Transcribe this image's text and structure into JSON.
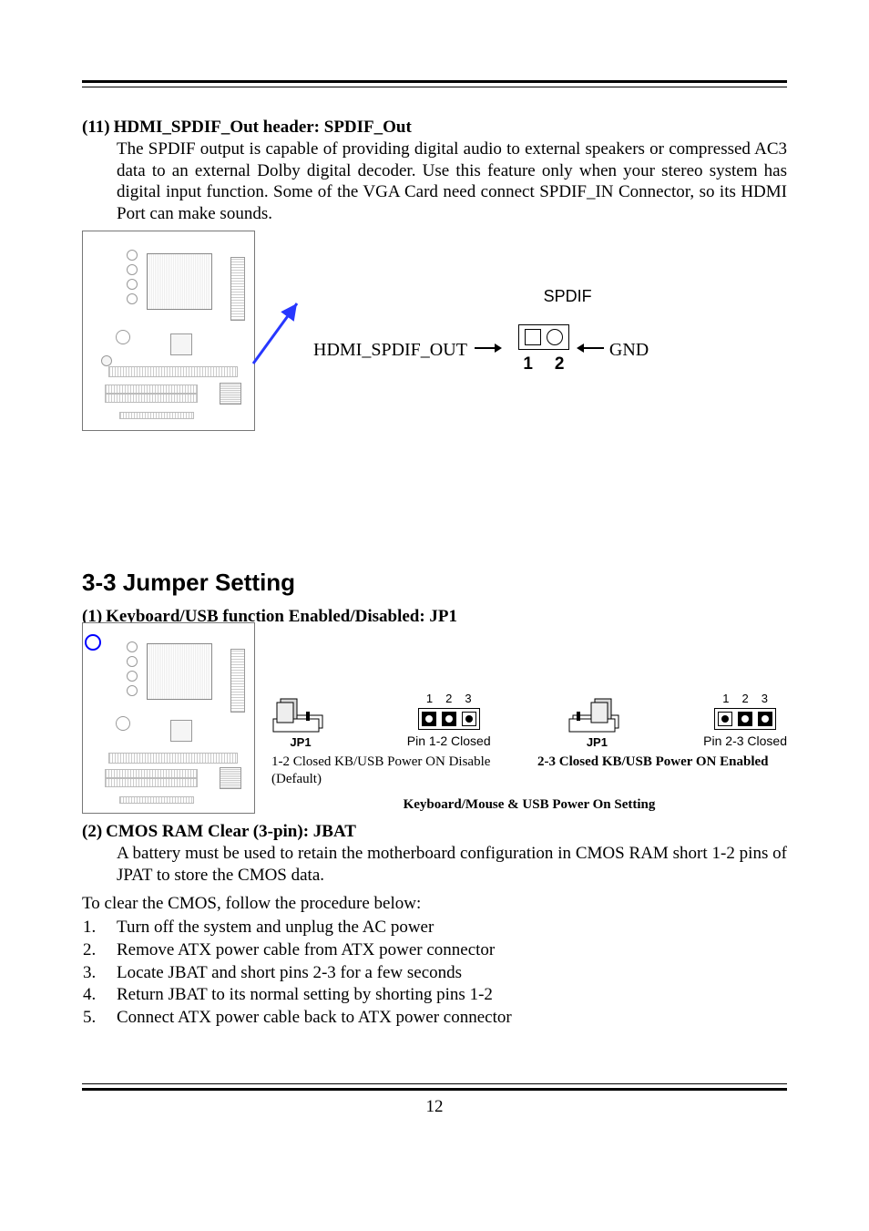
{
  "section_11": {
    "num": "(11)",
    "title": "HDMI_SPDIF_Out header: SPDIF_Out",
    "paragraph": "The SPDIF output is capable of providing digital audio to external speakers or compressed AC3 data to an external Dolby digital decoder. Use this feature only when your stereo system has digital input function. Some of the VGA Card need connect SPDIF_IN Connector, so its HDMI Port can make sounds.",
    "header_label": "SPDIF",
    "left_pin_label": "HDMI_SPDIF_OUT",
    "gnd_label": "GND",
    "pin1": "1",
    "pin2": "2"
  },
  "h2": "3-3 Jumper Setting",
  "section_1": {
    "num": "(1)",
    "title": "Keyboard/USB function Enabled/Disabled: JP1",
    "jp_label": "JP1",
    "pin_nums": [
      "1",
      "2",
      "3"
    ],
    "closed12": "Pin 1-2 Closed",
    "closed23": "Pin 2-3 Closed",
    "caption_left": "1-2 Closed KB/USB Power ON Disable (Default)",
    "caption_right": "2-3 Closed KB/USB Power ON Enabled",
    "caption_center": "Keyboard/Mouse & USB Power On Setting"
  },
  "section_2": {
    "num": "(2)",
    "title": "CMOS RAM Clear (3-pin): JBAT",
    "paragraph": "A battery must be used to retain the motherboard configuration in CMOS RAM short 1-2 pins of JPAT to store the CMOS data.",
    "intro": "To clear the CMOS, follow the procedure below:",
    "steps": [
      "Turn off the system and unplug the AC power",
      "Remove ATX power cable from ATX power connector",
      "Locate JBAT and short pins 2-3 for a few seconds",
      "Return JBAT to its normal setting by shorting pins 1-2",
      "Connect ATX power cable back to ATX power connector"
    ]
  },
  "page_number": "12"
}
